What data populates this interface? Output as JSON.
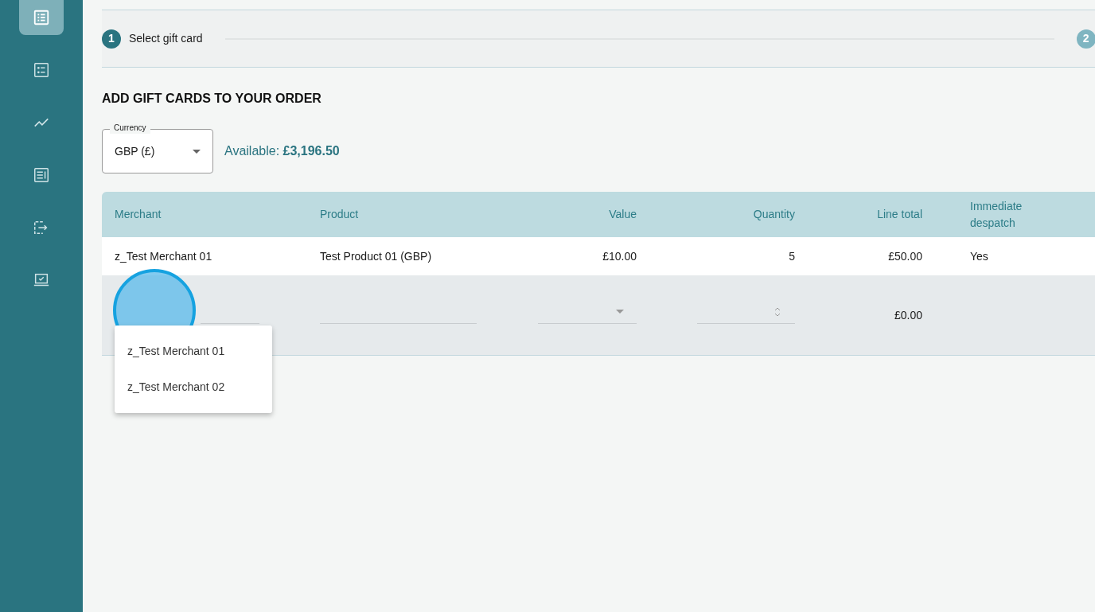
{
  "sidebar": {
    "items": [
      {
        "kind": "list",
        "selected": true
      },
      {
        "kind": "bullets",
        "selected": false
      },
      {
        "kind": "trend",
        "selected": false
      },
      {
        "kind": "article",
        "selected": false
      },
      {
        "kind": "transfer",
        "selected": false
      },
      {
        "kind": "laptop",
        "selected": false
      }
    ]
  },
  "stepper": {
    "steps": [
      {
        "number": "1",
        "label": "Select gift card",
        "active": true
      },
      {
        "number": "2",
        "active": false
      }
    ]
  },
  "heading": "ADD GIFT CARDS TO YOUR ORDER",
  "currency": {
    "label": "Currency",
    "value": "GBP (£)"
  },
  "available": "Available: **£3,196.50**",
  "table": {
    "columns": [
      {
        "label": "Merchant",
        "kind": "text"
      },
      {
        "label": "Product",
        "kind": "text"
      },
      {
        "label": "Value",
        "kind": "amount"
      },
      {
        "label": "Quantity",
        "kind": "amount"
      },
      {
        "label": "Line total",
        "kind": "amount"
      },
      {
        "label": "Immediate despatch",
        "kind": "text"
      }
    ],
    "rows": [
      [
        "z_Test Merchant 01",
        "Test Product 01 (GBP)",
        "£10.00",
        "5",
        "£50.00",
        "Yes"
      ]
    ],
    "new_row": {
      "line_total": "£0.00"
    }
  },
  "merchant_menu": {
    "options": [
      "z_Test Merchant 01",
      "z_Test Merchant 02"
    ]
  }
}
